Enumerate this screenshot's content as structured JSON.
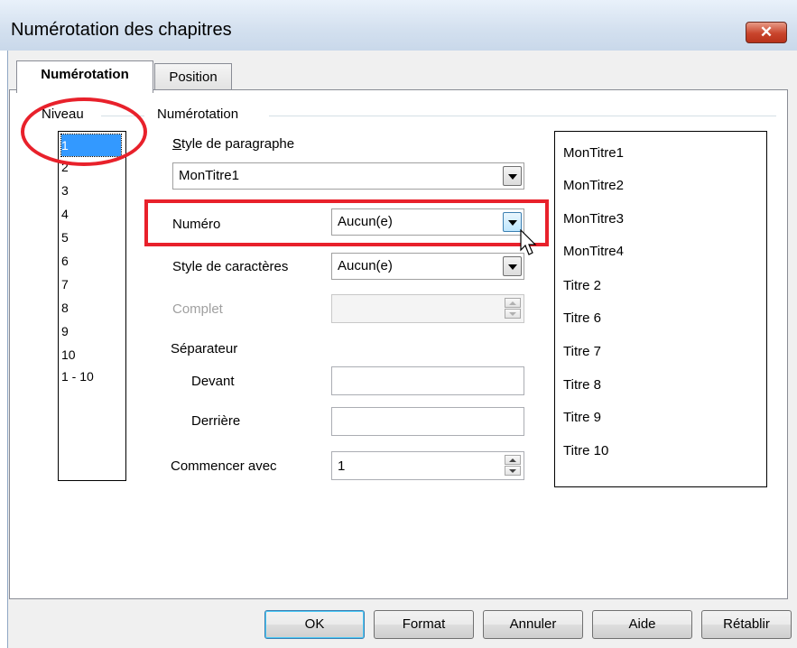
{
  "window": {
    "title": "Numérotation des chapitres",
    "close_icon_glyph": "✕"
  },
  "tabs": [
    {
      "label": "Numérotation",
      "active": true
    },
    {
      "label": "Position",
      "active": false
    }
  ],
  "niveau": {
    "title": "Niveau",
    "items": [
      "1",
      "2",
      "3",
      "4",
      "5",
      "6",
      "7",
      "8",
      "9",
      "10",
      "1 - 10"
    ],
    "selected": "1"
  },
  "numerotation": {
    "title": "Numérotation",
    "style_paragraphe_label": "Style de paragraphe",
    "style_paragraphe_value": "MonTitre1",
    "numero_label": "Numéro",
    "numero_value": "Aucun(e)",
    "style_caracteres_label": "Style de caractères",
    "style_caracteres_value": "Aucun(e)",
    "complet_label": "Complet",
    "complet_value": "",
    "separateur_label": "Séparateur",
    "devant_label": "Devant",
    "devant_value": "",
    "derriere_label": "Derrière",
    "derriere_value": "",
    "commencer_label": "Commencer avec",
    "commencer_value": "1"
  },
  "preview": {
    "lines": [
      "MonTitre1",
      "MonTitre2",
      "MonTitre3",
      "MonTitre4",
      "Titre 2",
      "Titre 6",
      "Titre 7",
      "Titre 8",
      "Titre 9",
      "Titre 10"
    ]
  },
  "buttons": {
    "ok": "OK",
    "format": "Format",
    "annuler": "Annuler",
    "aide": "Aide",
    "retablir": "Rétablir"
  },
  "colors": {
    "annotation_red": "#e8212b",
    "selection_blue": "#3399ff"
  }
}
